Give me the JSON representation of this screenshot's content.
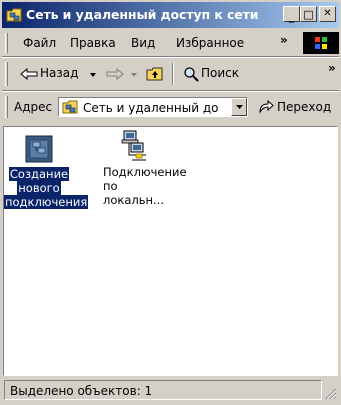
{
  "window": {
    "title": "Сеть и удаленный доступ к сети",
    "minimize_glyph": "_",
    "maximize_glyph": "□",
    "close_glyph": "✕"
  },
  "menubar": {
    "items": [
      "Файл",
      "Правка",
      "Вид",
      "Избранное"
    ],
    "overflow": "»"
  },
  "toolbar": {
    "back_label": "Назад",
    "search_label": "Поиск",
    "overflow": "»"
  },
  "addressbar": {
    "label": "Адрес",
    "value": "Сеть и удаленный до",
    "go_label": "Переход"
  },
  "content": {
    "items": [
      {
        "label_lines": [
          "Создание",
          "нового",
          "подключения"
        ],
        "icon": "make-new-connection-icon",
        "selected": true
      },
      {
        "label_lines": [
          "Подключение",
          "по локальн..."
        ],
        "icon": "lan-connection-icon",
        "selected": false
      }
    ]
  },
  "statusbar": {
    "text": "Выделено объектов: 1"
  },
  "colors": {
    "title_start": "#0a246a",
    "title_end": "#a6caf0",
    "face": "#d4d0c8",
    "selection": "#0a246a"
  }
}
